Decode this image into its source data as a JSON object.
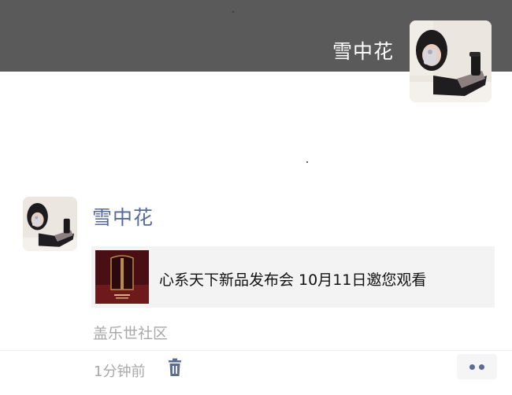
{
  "profile": {
    "name": "雪中花",
    "avatar_icon": "user-avatar-photo"
  },
  "post": {
    "author": "雪中花",
    "link": {
      "title": "心系天下新品发布会 10月11日邀您观看",
      "thumbnail_icon": "phone-launch-thumbnail"
    },
    "source": "盖乐世社区",
    "time": "1分钟前",
    "delete_icon": "trash-icon",
    "more_icon": "more-dots-icon"
  },
  "colors": {
    "cover": "#5a5a5a",
    "author_name": "#576b95",
    "meta_text": "#a8a8a8",
    "link_card_bg": "#f3f3f3",
    "accent_dots": "#5b6e92"
  }
}
